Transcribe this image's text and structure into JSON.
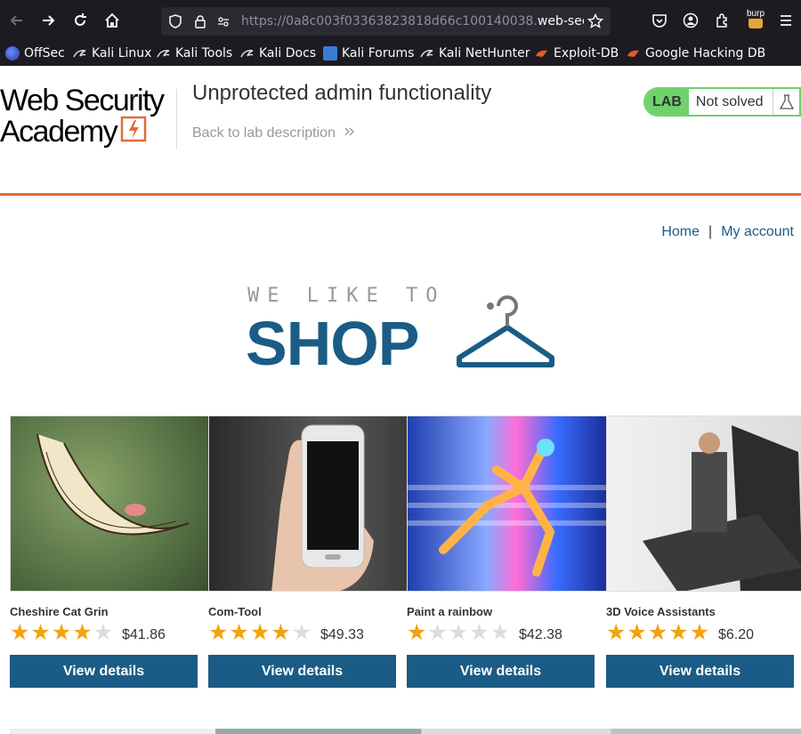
{
  "browser": {
    "url_prefix": "https://0a8c003f03363823818d66c100140038.",
    "url_domain": "web-sec",
    "burp_label": "burp"
  },
  "bookmarks": [
    {
      "label": "OffSec",
      "icon": "offsec-icon"
    },
    {
      "label": "Kali Linux",
      "icon": "kali-dragon-icon"
    },
    {
      "label": "Kali Tools",
      "icon": "kali-dragon-icon"
    },
    {
      "label": "Kali Docs",
      "icon": "kali-dragon-icon"
    },
    {
      "label": "Kali Forums",
      "icon": "kali-forums-icon"
    },
    {
      "label": "Kali NetHunter",
      "icon": "kali-dragon-icon"
    },
    {
      "label": "Exploit-DB",
      "icon": "exploitdb-icon"
    },
    {
      "label": "Google Hacking DB",
      "icon": "exploitdb-icon"
    }
  ],
  "academy": {
    "logo_line1": "Web Security",
    "logo_line2": "Academy",
    "lab_title": "Unprotected admin functionality",
    "back_link": "Back to lab description",
    "lab_badge": "LAB",
    "lab_status": "Not solved"
  },
  "nav": {
    "home": "Home",
    "separator": "|",
    "my_account": "My account"
  },
  "banner": {
    "small": "WE LIKE TO",
    "big": "SHOP"
  },
  "products": [
    {
      "name": "Cheshire Cat Grin",
      "rating": 4,
      "price": "$41.86",
      "button": "View details"
    },
    {
      "name": "Com-Tool",
      "rating": 4,
      "price": "$49.33",
      "button": "View details"
    },
    {
      "name": "Paint a rainbow",
      "rating": 1,
      "price": "$42.38",
      "button": "View details"
    },
    {
      "name": "3D Voice Assistants",
      "rating": 5,
      "price": "$6.20",
      "button": "View details"
    }
  ],
  "colors": {
    "brand": "#1a5c85",
    "accent": "#e06c3c",
    "lab_green": "#70d16d",
    "star": "#f2a30f"
  }
}
